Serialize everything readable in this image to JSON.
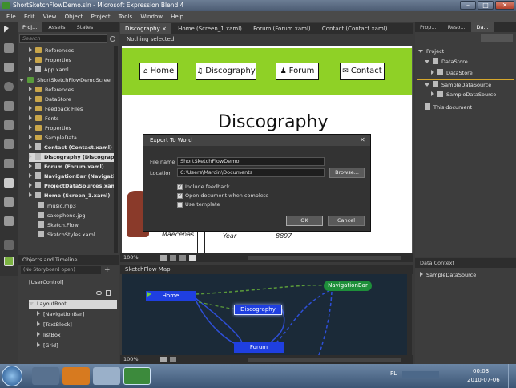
{
  "window": {
    "title": "ShortSketchFlowDemo.sln - Microsoft Expression Blend 4"
  },
  "menu": [
    "File",
    "Edit",
    "View",
    "Object",
    "Project",
    "Tools",
    "Window",
    "Help"
  ],
  "left_panel": {
    "tabs": [
      "Proj...",
      "Assets",
      "States"
    ],
    "search_placeholder": "Search",
    "items": [
      {
        "label": "References",
        "bold": false
      },
      {
        "label": "Properties",
        "bold": false
      },
      {
        "label": "App.xaml",
        "bold": false
      },
      {
        "label": "ShortSketchFlowDemoScree",
        "bold": false
      },
      {
        "label": "References",
        "bold": false
      },
      {
        "label": "DataStore",
        "bold": false
      },
      {
        "label": "Feedback Files",
        "bold": false
      },
      {
        "label": "Fonts",
        "bold": false
      },
      {
        "label": "Properties",
        "bold": false
      },
      {
        "label": "SampleData",
        "bold": false
      },
      {
        "label": "Contact (Contact.xaml)",
        "bold": true
      },
      {
        "label": "Discography (Discograpl",
        "bold": true
      },
      {
        "label": "Forum (Forum.xaml)",
        "bold": true
      },
      {
        "label": "NavigationBar (Navigati",
        "bold": true
      },
      {
        "label": "ProjectDataSources.xam",
        "bold": true
      },
      {
        "label": "Home (Screen_1.xaml)",
        "bold": true
      },
      {
        "label": "music.mp3",
        "bold": false
      },
      {
        "label": "saxophone.jpg",
        "bold": false
      },
      {
        "label": "Sketch.Flow",
        "bold": false
      },
      {
        "label": "SketchStyles.xaml",
        "bold": false
      }
    ]
  },
  "objects_timeline": {
    "title": "Objects and Timeline",
    "storyboard": "(No Storyboard open)",
    "items": [
      "[UserControl]",
      "LayoutRoot",
      "[NavigationBar]",
      "[TextBlock]",
      "listBox",
      "[Grid]"
    ]
  },
  "doc_tabs": [
    "Discography",
    "Home (Screen_1.xaml)",
    "Forum (Forum.xaml)",
    "Contact (Contact.xaml)"
  ],
  "status": {
    "selection": "Nothing selected",
    "zoom": "100%"
  },
  "artboard": {
    "nav": [
      {
        "icon": "⌂",
        "label": "Home"
      },
      {
        "icon": "♫",
        "label": "Discography"
      },
      {
        "icon": "♟",
        "label": "Forum"
      },
      {
        "icon": "✉",
        "label": "Contact"
      }
    ],
    "heading": "Discography",
    "row1": "Maecenas",
    "row2_label": "Year",
    "row2_value": "8897"
  },
  "dialog": {
    "title": "Export To Word",
    "file_name_label": "File name",
    "file_name": "ShortSketchFlowDemo",
    "location_label": "Location",
    "location": "C:\\Users\\Marcin\\Documents",
    "browse": "Browse...",
    "options": [
      {
        "label": "Include feedback",
        "checked": true
      },
      {
        "label": "Open document when complete",
        "checked": true
      },
      {
        "label": "Use template",
        "checked": false
      }
    ],
    "ok": "OK",
    "cancel": "Cancel"
  },
  "sketchflow_map": {
    "title": "SketchFlow Map",
    "nodes": [
      "Home",
      "Discography",
      "Forum",
      "NavigationBar"
    ],
    "zoom": "100%"
  },
  "right_panel": {
    "tabs": [
      "Prop...",
      "Reso...",
      "Da..."
    ],
    "items": [
      "Project",
      "DataStore",
      "DataStore",
      "SampleDataSource",
      "SampleDataSource",
      "This document"
    ],
    "context_title": "Data Context",
    "context_item": "SampleDataSource"
  },
  "taskbar": {
    "lang": "PL",
    "time": "00:03",
    "date": "2010-07-06"
  },
  "colors": {
    "accent": "#8fd126",
    "map_node": "#1f3fe0",
    "nav_node": "#1e8f3a"
  }
}
